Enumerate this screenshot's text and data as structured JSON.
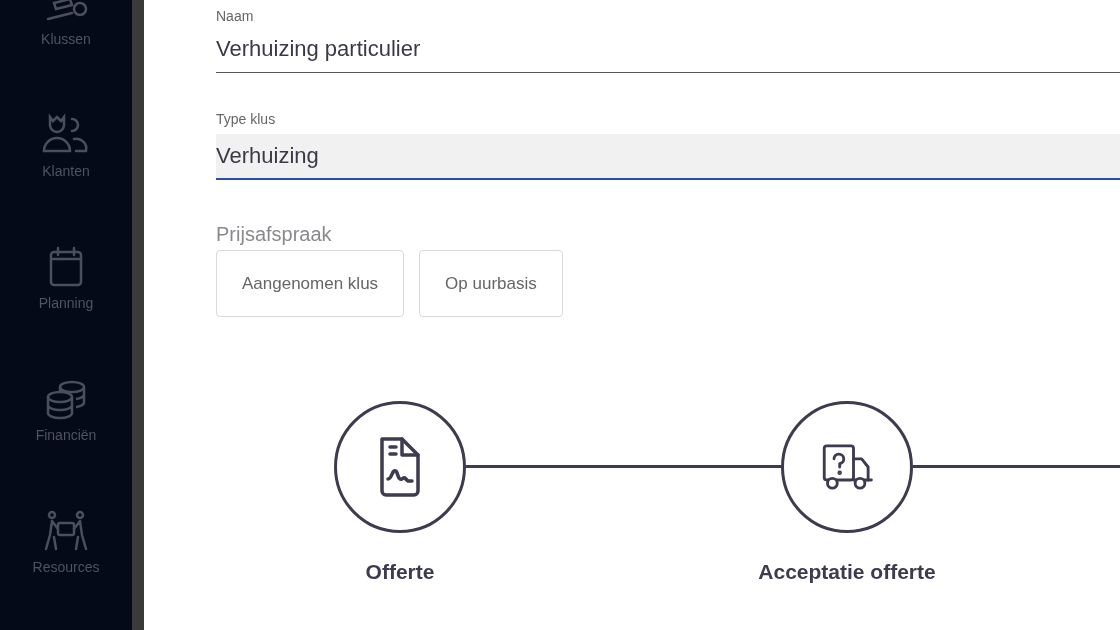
{
  "sidebar": {
    "items": [
      {
        "label": "Klussen"
      },
      {
        "label": "Klanten"
      },
      {
        "label": "Planning"
      },
      {
        "label": "Financiën"
      },
      {
        "label": "Resources"
      }
    ]
  },
  "form": {
    "name_field": {
      "label": "Naam",
      "value": "Verhuizing particulier"
    },
    "type_field": {
      "label": "Type klus",
      "value": "Verhuizing"
    },
    "price_agreement": {
      "label": "Prijsafspraak",
      "options": [
        {
          "label": "Aangenomen klus",
          "selected": false
        },
        {
          "label": "Op uurbasis",
          "selected": false
        }
      ]
    }
  },
  "steps": [
    {
      "label": "Offerte"
    },
    {
      "label": "Acceptatie offerte"
    }
  ]
}
